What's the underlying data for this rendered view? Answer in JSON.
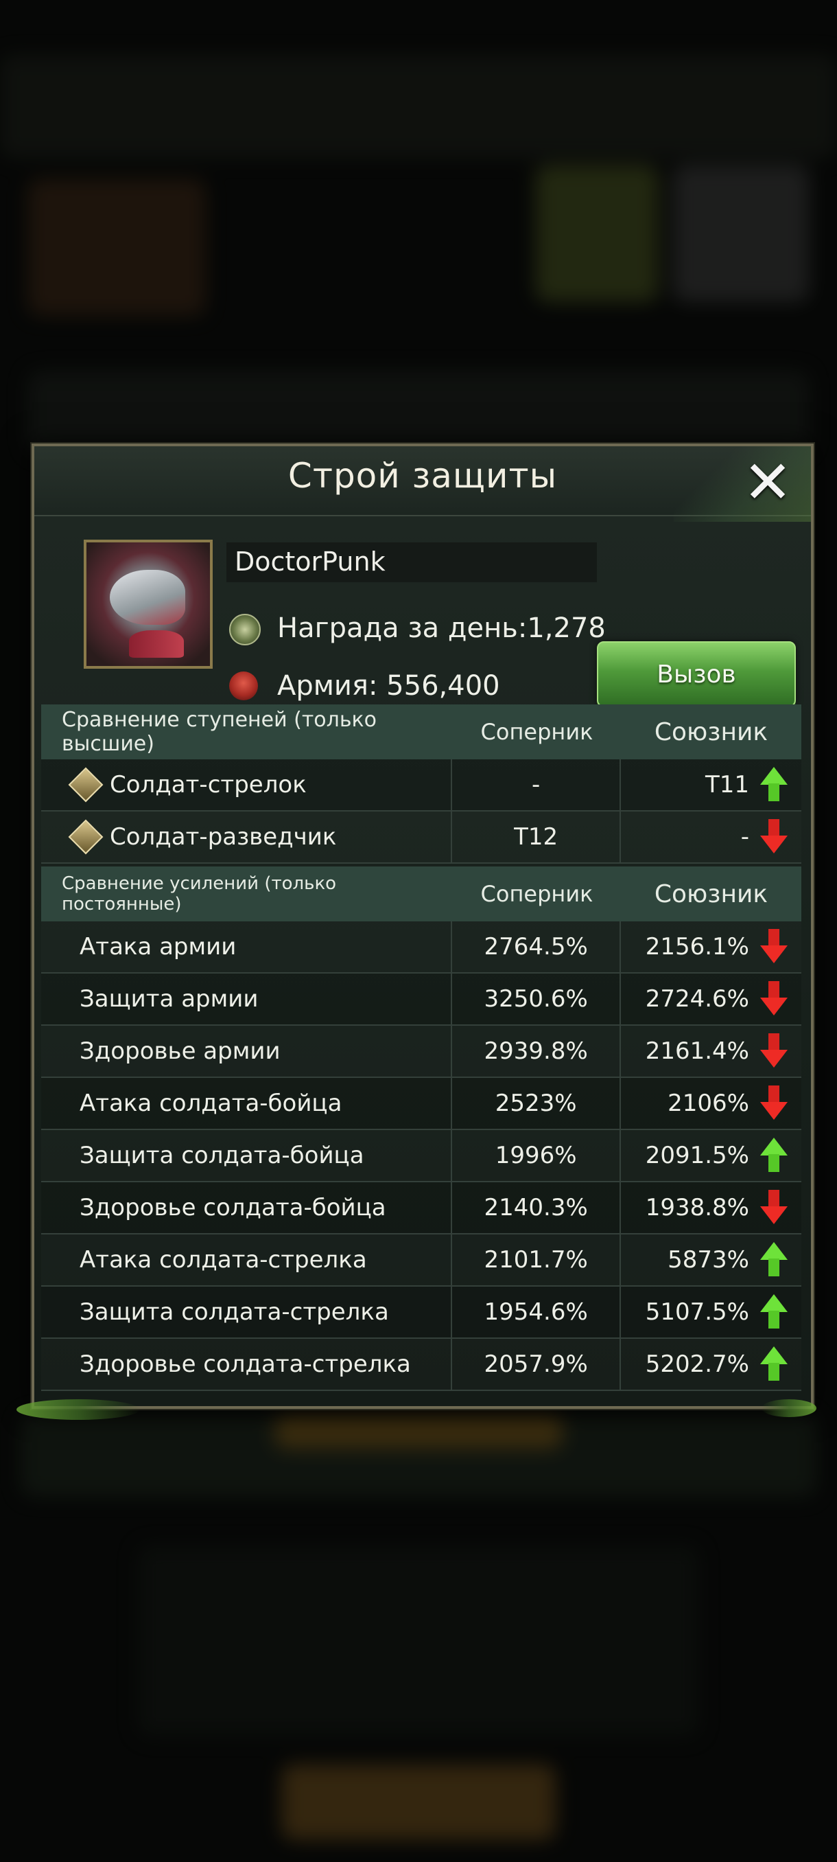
{
  "dialog": {
    "title": "Строй защиты",
    "close_icon": "close-icon"
  },
  "profile": {
    "name": "DoctorPunk",
    "reward_text": "Награда за день:1,278",
    "army_text": "Армия: 556,400",
    "challenge_label": "Вызов"
  },
  "tier_table": {
    "header": [
      "Сравнение ступеней (только высшие)",
      "Соперник",
      "Союзник"
    ],
    "rows": [
      {
        "label": "Солдат-стрелок",
        "rival": "-",
        "ally": "T11",
        "trend": "up"
      },
      {
        "label": "Солдат-разведчик",
        "rival": "T12",
        "ally": "-",
        "trend": "down"
      }
    ]
  },
  "boost_table": {
    "header": [
      "Сравнение усилений (только постоянные)",
      "Соперник",
      "Союзник"
    ],
    "rows": [
      {
        "label": "Атака армии",
        "rival": "2764.5%",
        "ally": "2156.1%",
        "trend": "down"
      },
      {
        "label": "Защита армии",
        "rival": "3250.6%",
        "ally": "2724.6%",
        "trend": "down"
      },
      {
        "label": "Здоровье армии",
        "rival": "2939.8%",
        "ally": "2161.4%",
        "trend": "down"
      },
      {
        "label": "Атака солдата-бойца",
        "rival": "2523%",
        "ally": "2106%",
        "trend": "down"
      },
      {
        "label": "Защита солдата-бойца",
        "rival": "1996%",
        "ally": "2091.5%",
        "trend": "up"
      },
      {
        "label": "Здоровье солдата-бойца",
        "rival": "2140.3%",
        "ally": "1938.8%",
        "trend": "down"
      },
      {
        "label": "Атака солдата-стрелка",
        "rival": "2101.7%",
        "ally": "5873%",
        "trend": "up"
      },
      {
        "label": "Защита солдата-стрелка",
        "rival": "1954.6%",
        "ally": "5107.5%",
        "trend": "up"
      },
      {
        "label": "Здоровье солдата-стрелка",
        "rival": "2057.9%",
        "ally": "5202.7%",
        "trend": "up"
      }
    ]
  },
  "colors": {
    "up_arrow": "#6ee23a",
    "down_arrow": "#ee2b25",
    "header_bg": "#2f463d",
    "challenge_button": "#4f9a3a"
  }
}
